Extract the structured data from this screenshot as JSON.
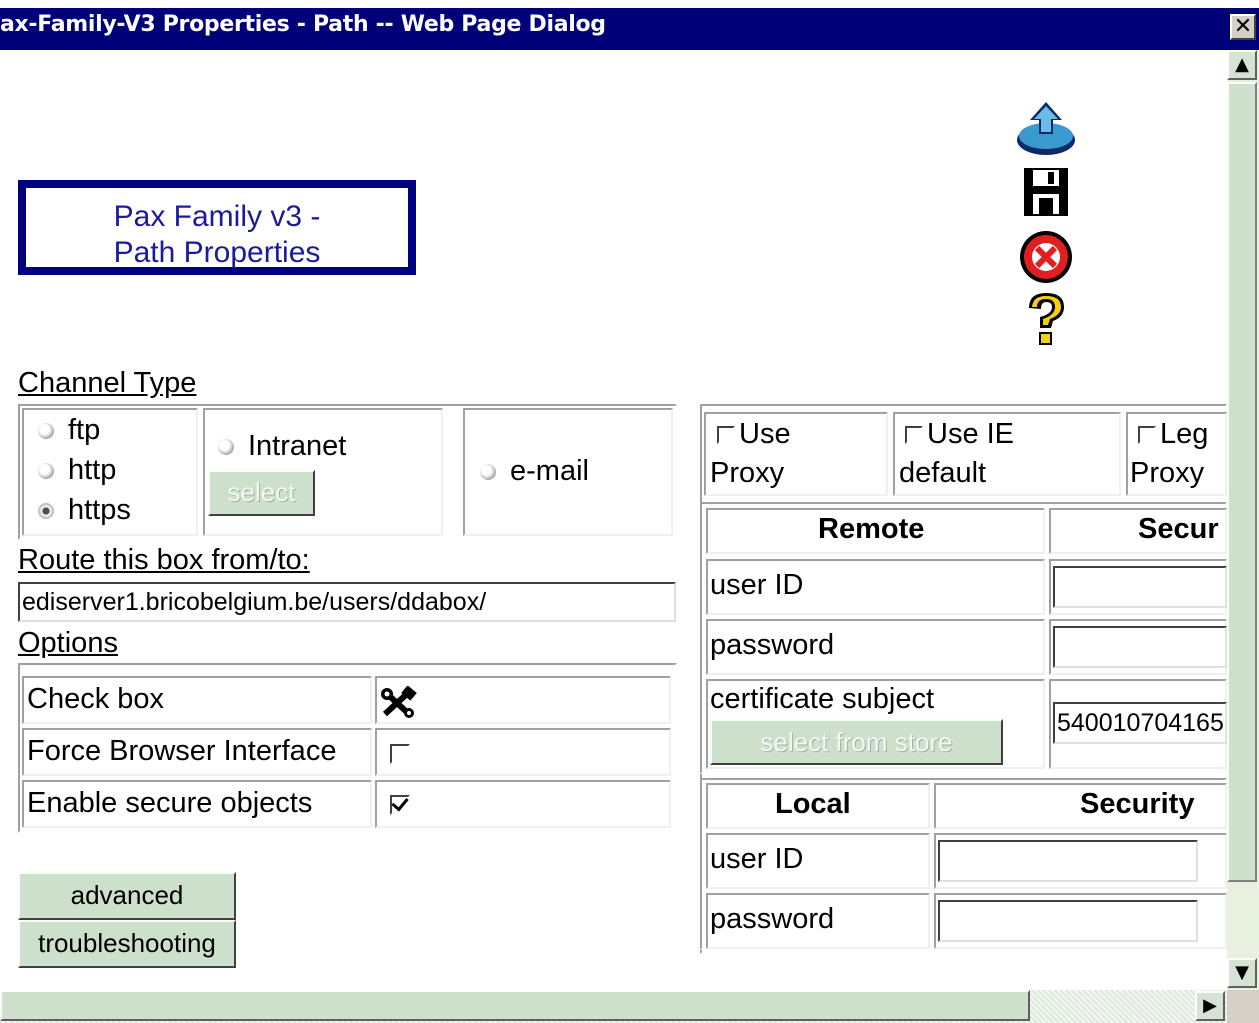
{
  "window": {
    "title": "ax-Family-V3 Properties - Path -- Web Page Dialog",
    "close_label": "✕"
  },
  "header": {
    "line1": "Pax Family v3 -",
    "line2": "Path Properties"
  },
  "toolbar": {
    "icons": [
      "upload-icon",
      "save-icon",
      "cancel-icon",
      "help-icon"
    ]
  },
  "channel_type": {
    "label": "Channel Type",
    "options": [
      {
        "label": "ftp",
        "checked": false
      },
      {
        "label": "http",
        "checked": false
      },
      {
        "label": "https",
        "checked": true
      }
    ],
    "intranet_label": "Intranet",
    "select_label": "select",
    "email_label": "e-mail"
  },
  "route": {
    "label": "Route this box from/to:",
    "value": "ediserver1.bricobelgium.be/users/ddabox/"
  },
  "options": {
    "label": "Options",
    "rows": [
      {
        "label": "Check box"
      },
      {
        "label": "Force Browser Interface",
        "checked": false
      },
      {
        "label": "Enable secure objects",
        "checked": true
      }
    ]
  },
  "buttons": {
    "advanced": "advanced",
    "troubleshooting": "troubleshooting"
  },
  "proxy": {
    "use_proxy_1": "Use",
    "use_proxy_2": "Proxy",
    "use_ie_1": "Use IE",
    "use_ie_2": "default",
    "legacy_1": "Leg",
    "legacy_2": "Proxy"
  },
  "remote": {
    "header": "Remote",
    "security_header": "Secur",
    "user_id_label": "user ID",
    "password_label": "password",
    "cert_label": "certificate subject",
    "cert_value": "540010704165",
    "select_from_store": "select from store"
  },
  "local": {
    "header": "Local",
    "security_header": "Security",
    "user_id_label": "user ID",
    "password_label": "password"
  }
}
